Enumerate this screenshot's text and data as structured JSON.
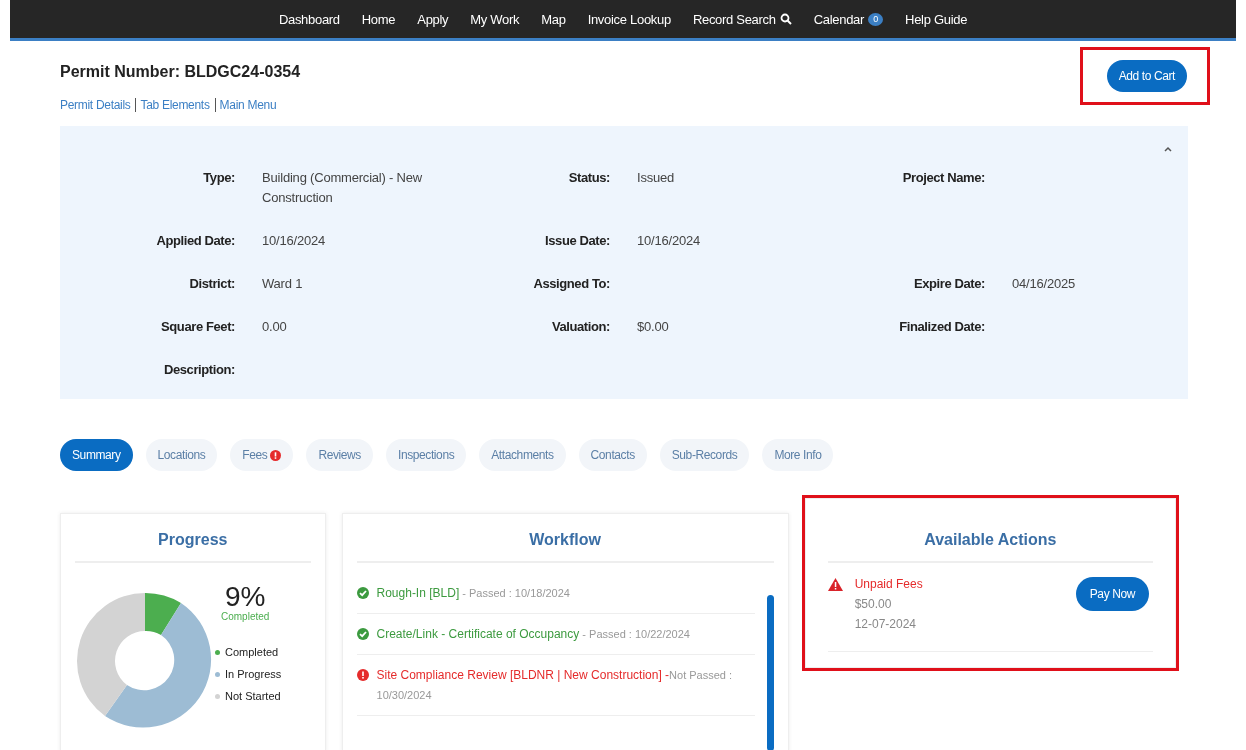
{
  "nav": [
    {
      "label": "Dashboard"
    },
    {
      "label": "Home"
    },
    {
      "label": "Apply"
    },
    {
      "label": "My Work"
    },
    {
      "label": "Map"
    },
    {
      "label": "Invoice Lookup"
    },
    {
      "label": "Record Search",
      "kind": "search"
    },
    {
      "label": "Calendar",
      "kind": "badge",
      "badge": "0"
    },
    {
      "label": "Help Guide"
    }
  ],
  "header": {
    "title": "Permit Number: BLDGC24-0354",
    "links": [
      "Permit Details",
      "Tab Elements",
      "Main Menu"
    ],
    "cart_button": {
      "label": "Add to Cart",
      "highlighted": true
    }
  },
  "details": {
    "expanded": true,
    "rows": [
      [
        {
          "label": "Type:",
          "value": "Building (Commercial) - New Construction"
        },
        {
          "label": "Status:",
          "value": "Issued"
        },
        {
          "label": "Project Name:"
        }
      ],
      [
        {
          "label": "Applied Date:",
          "value": "10/16/2024"
        },
        {
          "label": "Issue Date:",
          "value": "10/16/2024"
        },
        {}
      ],
      [
        {
          "label": "District:",
          "value": "Ward 1"
        },
        {
          "label": "Assigned To:"
        },
        {
          "label": "Expire Date:",
          "value": "04/16/2025"
        }
      ],
      [
        {
          "label": "Square Feet:",
          "value": "0.00"
        },
        {
          "label": "Valuation:",
          "value": "$0.00"
        },
        {
          "label": "Finalized Date:"
        }
      ],
      [
        {
          "label": "Description:"
        }
      ]
    ]
  },
  "tabs": [
    {
      "label": "Summary",
      "selected": true
    },
    {
      "label": "Locations",
      "selected": false
    },
    {
      "label": "Fees",
      "selected": false,
      "alert": true
    },
    {
      "label": "Reviews",
      "selected": false
    },
    {
      "label": "Inspections",
      "selected": false
    },
    {
      "label": "Attachments",
      "selected": false
    },
    {
      "label": "Contacts",
      "selected": false
    },
    {
      "label": "Sub-Records",
      "selected": false
    },
    {
      "label": "More Info",
      "selected": false
    }
  ],
  "progress": {
    "title": "Progress",
    "percent": "9%",
    "caption": "Completed",
    "legend": [
      {
        "label": "Completed",
        "color": "#4cae4f"
      },
      {
        "label": "In Progress",
        "color": "#9dbcd4"
      },
      {
        "label": "Not Started",
        "color": "#d3d3d3"
      }
    ]
  },
  "workflow": {
    "title": "Workflow",
    "items": [
      {
        "kind": "passed",
        "name": "Rough-In [BLD]",
        "detail": " - Passed : 10/18/2024"
      },
      {
        "kind": "passed",
        "name": "Create/Link - Certificate of Occupancy",
        "detail": " - Passed : 10/22/2024"
      },
      {
        "kind": "failed",
        "name": "Site Compliance Review [BLDNR | New Construction] -",
        "detail": "Not Passed : 10/30/2024"
      }
    ]
  },
  "actions": {
    "title": "Available Actions",
    "highlighted": true,
    "items": [
      {
        "name": "Unpaid Fees",
        "amount": "$50.00",
        "date": "12-07-2024",
        "button": "Pay Now"
      }
    ]
  }
}
